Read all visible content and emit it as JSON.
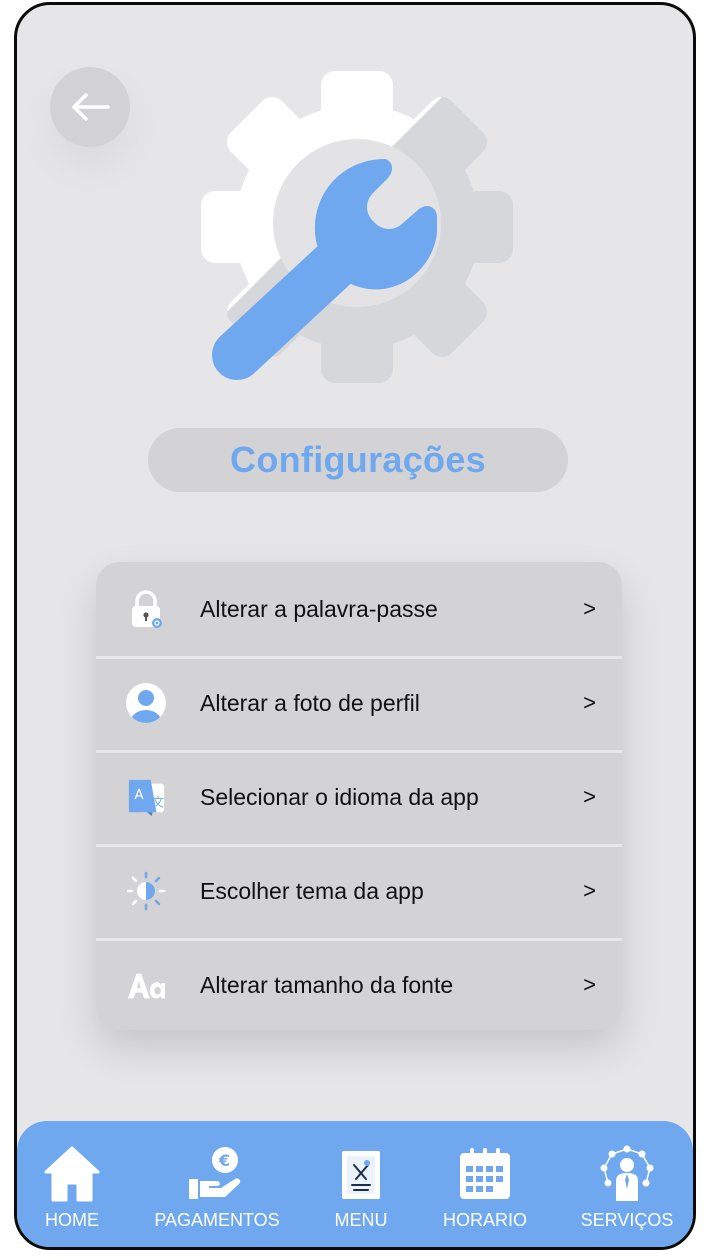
{
  "header": {
    "back_icon": "arrow-left-icon",
    "hero_icon": "gear-wrench-icon"
  },
  "title": "Configurações",
  "settings": [
    {
      "label": "Alterar a palavra-passe",
      "icon": "lock-icon",
      "chevron": ">"
    },
    {
      "label": "Alterar a foto de perfil",
      "icon": "user-avatar-icon",
      "chevron": ">"
    },
    {
      "label": "Selecionar o idioma da app",
      "icon": "translate-icon",
      "chevron": ">"
    },
    {
      "label": "Escolher tema da app",
      "icon": "brightness-icon",
      "chevron": ">"
    },
    {
      "label": "Alterar tamanho da fonte",
      "icon": "font-size-icon",
      "chevron": ">"
    }
  ],
  "nav": [
    {
      "label": "HOME",
      "icon": "home-icon"
    },
    {
      "label": "PAGAMENTOS",
      "icon": "payment-icon"
    },
    {
      "label": "MENU",
      "icon": "menu-icon"
    },
    {
      "label": "HORARIO",
      "icon": "calendar-icon"
    },
    {
      "label": "SERVIÇOS",
      "icon": "services-icon"
    }
  ],
  "colors": {
    "accent": "#6fa8ee",
    "background": "#e6e6e8",
    "card": "#d3d3d5"
  }
}
